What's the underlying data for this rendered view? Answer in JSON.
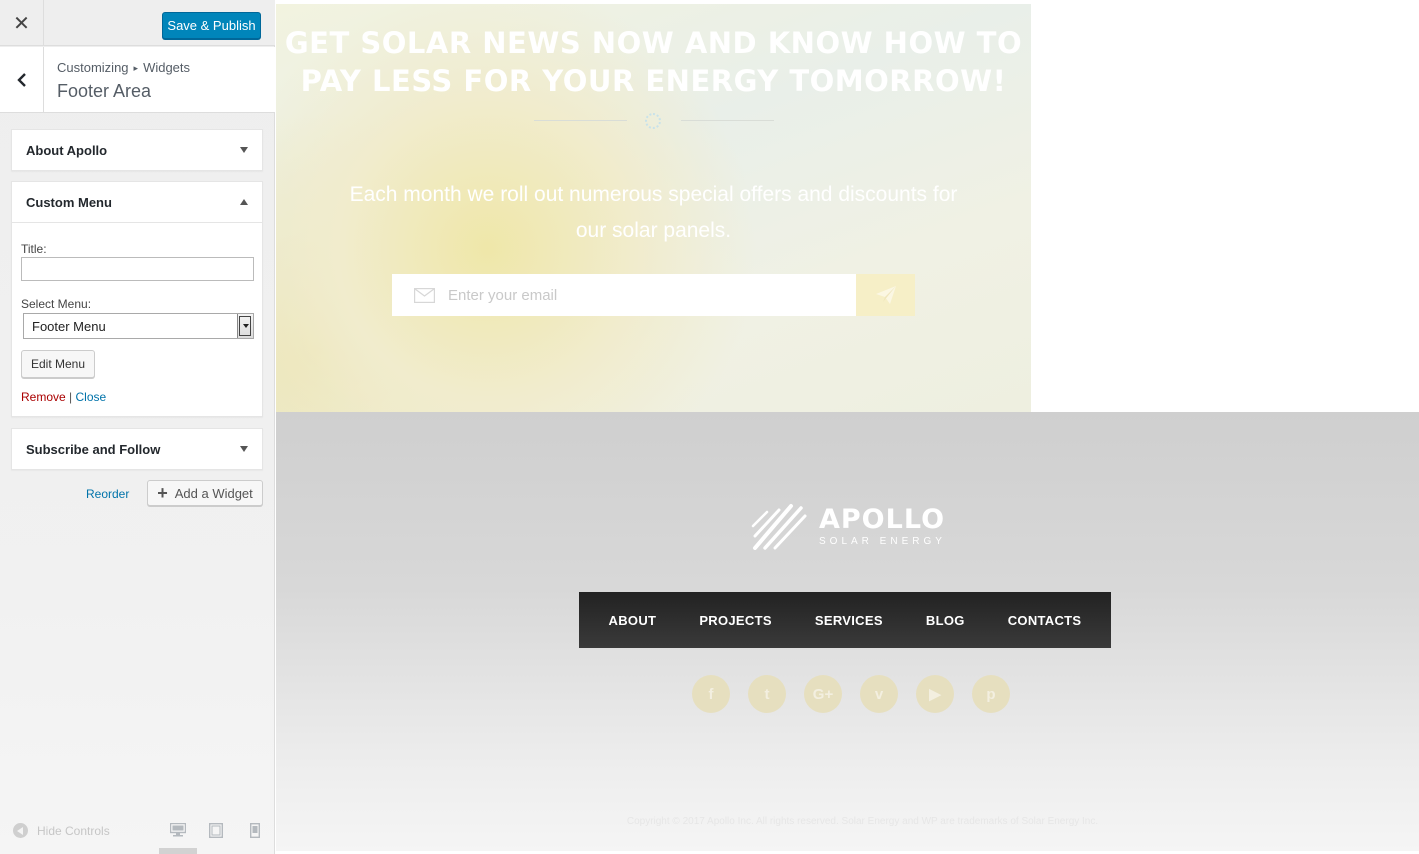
{
  "topbar": {
    "close_glyph": "✕",
    "publish_label": "Save & Publish",
    "accent": "#0085ba"
  },
  "section": {
    "breadcrumb_root": "Customizing",
    "breadcrumb_sep": "▸",
    "breadcrumb_current": "Widgets",
    "title": "Footer Area"
  },
  "widgets": [
    {
      "title": "About Apollo",
      "expanded": false
    },
    {
      "title": "Custom Menu",
      "expanded": true,
      "title_label": "Title:",
      "title_value": "",
      "menu_label": "Select Menu:",
      "menu_value": "Footer Menu",
      "edit_label": "Edit Menu",
      "remove_label": "Remove",
      "pipe": "|",
      "close_label": "Close"
    },
    {
      "title": "Subscribe and Follow",
      "expanded": false
    }
  ],
  "actions": {
    "reorder_label": "Reorder",
    "add_widget_label": "Add a Widget"
  },
  "bottom": {
    "hide_controls_label": "Hide Controls",
    "devices": [
      "desktop-icon",
      "tablet-icon",
      "mobile-icon"
    ]
  },
  "preview": {
    "hero_heading_line1": "GET SOLAR NEWS NOW AND KNOW HOW TO",
    "hero_heading_line2": "PAY LESS FOR YOUR ENERGY TOMORROW!",
    "hero_sub_line1": "Each month we roll out numerous special offers and discounts for",
    "hero_sub_line2": "our solar panels.",
    "email_placeholder": "Enter your email",
    "logo_name": "APOLLO",
    "logo_tagline": "SOLAR ENERGY",
    "nav": [
      "ABOUT",
      "PROJECTS",
      "SERVICES",
      "BLOG",
      "CONTACTS"
    ],
    "socials": [
      {
        "icon": "facebook-icon",
        "glyph": "f"
      },
      {
        "icon": "twitter-icon",
        "glyph": "t"
      },
      {
        "icon": "google-plus-icon",
        "glyph": "G+"
      },
      {
        "icon": "vimeo-icon",
        "glyph": "v"
      },
      {
        "icon": "youtube-icon",
        "glyph": "▶"
      },
      {
        "icon": "pinterest-icon",
        "glyph": "p"
      }
    ],
    "copyright": "Copyright © 2017 Apollo Inc. All rights reserved. Solar Energy and WP are trademarks of Solar Energy Inc."
  }
}
